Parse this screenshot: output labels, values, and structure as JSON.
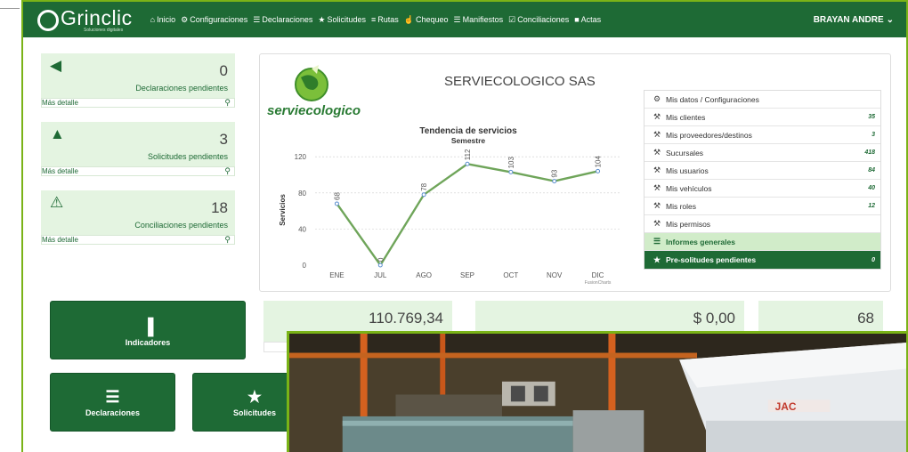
{
  "brand": {
    "name": "Grinclic",
    "tagline": "Soluciones digitales"
  },
  "nav": [
    {
      "icon": "home-icon",
      "glyph": "⌂",
      "label": "Inicio"
    },
    {
      "icon": "gear-icon",
      "glyph": "⚙",
      "label": "Configuraciones"
    },
    {
      "icon": "list-icon",
      "glyph": "☰",
      "label": "Declaraciones"
    },
    {
      "icon": "star-icon",
      "glyph": "★",
      "label": "Solicitudes"
    },
    {
      "icon": "road-icon",
      "glyph": "≡",
      "label": "Rutas"
    },
    {
      "icon": "thumbs-up-icon",
      "glyph": "☝",
      "label": "Chequeo"
    },
    {
      "icon": "list-alt-icon",
      "glyph": "☰",
      "label": "Manifiestos"
    },
    {
      "icon": "check-square-icon",
      "glyph": "☑",
      "label": "Conciliaciones"
    },
    {
      "icon": "file-icon",
      "glyph": "■",
      "label": "Actas"
    }
  ],
  "user": {
    "name": "BRAYAN ANDRE",
    "caret": "⌄"
  },
  "stats": [
    {
      "icon": "megaphone-icon",
      "glyph": "◀",
      "value": "0",
      "label": "Declaraciones pendientes",
      "more": "Más detalle"
    },
    {
      "icon": "bell-icon",
      "glyph": "▲",
      "value": "3",
      "label": "Solicitudes pendientes",
      "more": "Más detalle"
    },
    {
      "icon": "warning-icon",
      "glyph": "⚠",
      "value": "18",
      "label": "Conciliaciones pendientes",
      "more": "Más detalle"
    }
  ],
  "company": "SERVIECOLOGICO SAS",
  "company_logo_text": "serviecologico",
  "menu": [
    {
      "icon": "gear-icon",
      "glyph": "⚙",
      "label": "Mis datos / Configuraciones",
      "count": "",
      "style": ""
    },
    {
      "icon": "wrench-icon",
      "glyph": "⚒",
      "label": "Mis clientes",
      "count": "35",
      "style": ""
    },
    {
      "icon": "wrench-icon",
      "glyph": "⚒",
      "label": "Mis proveedores/destinos",
      "count": "3",
      "style": ""
    },
    {
      "icon": "wrench-icon",
      "glyph": "⚒",
      "label": "Sucursales",
      "count": "418",
      "style": ""
    },
    {
      "icon": "wrench-icon",
      "glyph": "⚒",
      "label": "Mis usuarios",
      "count": "84",
      "style": ""
    },
    {
      "icon": "wrench-icon",
      "glyph": "⚒",
      "label": "Mis vehículos",
      "count": "40",
      "style": ""
    },
    {
      "icon": "wrench-icon",
      "glyph": "⚒",
      "label": "Mis roles",
      "count": "12",
      "style": ""
    },
    {
      "icon": "wrench-icon",
      "glyph": "⚒",
      "label": "Mis permisos",
      "count": "",
      "style": ""
    },
    {
      "icon": "list-icon",
      "glyph": "☰",
      "label": "Informes generales",
      "count": "",
      "style": "hl"
    },
    {
      "icon": "star-icon",
      "glyph": "★",
      "label": "Pre-solitudes pendientes",
      "count": "0",
      "style": "dk"
    }
  ],
  "buttons": [
    {
      "name": "indicadores-button",
      "icon": "bar-chart-icon",
      "glyph": "▐",
      "label": "Indicadores"
    },
    {
      "name": "declaraciones-button",
      "icon": "list-icon",
      "glyph": "☰",
      "label": "Declaraciones"
    },
    {
      "name": "solicitudes-button",
      "icon": "star-icon",
      "glyph": "★",
      "label": "Solicitudes"
    }
  ],
  "tiles": [
    {
      "value": "110.769,34"
    },
    {
      "value": "$ 0,00"
    },
    {
      "value": "68"
    }
  ],
  "chart_data": {
    "type": "line",
    "title": "Tendencia de servicios",
    "subtitle": "Semestre",
    "ylabel": "Servicios",
    "categories": [
      "ENE",
      "JUL",
      "AGO",
      "SEP",
      "OCT",
      "NOV",
      "DIC"
    ],
    "values": [
      68,
      0,
      78,
      112,
      103,
      93,
      104
    ],
    "yticks": [
      0,
      40,
      80,
      120
    ],
    "ylim": [
      0,
      130
    ],
    "credit": "FusionCharts",
    "colors": {
      "line": "#6fa55a",
      "marker": "#5b8fcf"
    }
  }
}
